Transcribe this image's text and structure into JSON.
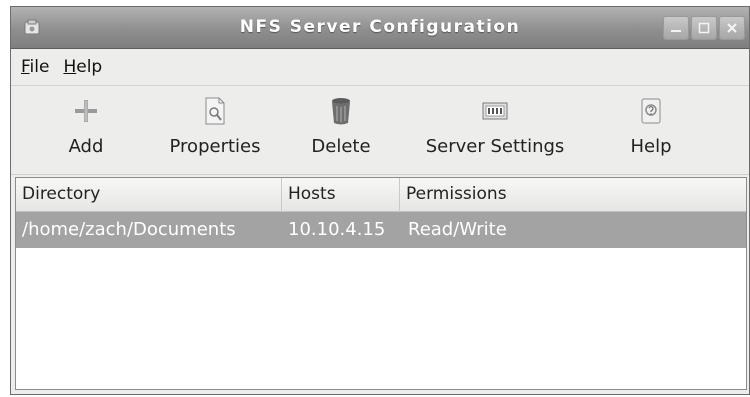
{
  "window": {
    "title": "NFS Server Configuration"
  },
  "menubar": {
    "items": [
      {
        "mnemonic": "F",
        "rest": "ile"
      },
      {
        "mnemonic": "H",
        "rest": "elp"
      }
    ]
  },
  "toolbar": {
    "add_label": "Add",
    "properties_label": "Properties",
    "delete_label": "Delete",
    "server_settings_label": "Server Settings",
    "help_label": "Help"
  },
  "table": {
    "columns": [
      "Directory",
      "Hosts",
      "Permissions"
    ],
    "rows": [
      {
        "directory": "/home/zach/Documents",
        "hosts": "10.10.4.15",
        "permissions": "Read/Write",
        "selected": true
      }
    ]
  },
  "colors": {
    "selected_row": "#a3a3a3",
    "titlebar": "#8f8f8f"
  },
  "icons": {
    "app": "nfs-app-icon",
    "add": "plus-icon",
    "properties": "properties-icon",
    "delete": "trash-icon",
    "server_settings": "server-settings-icon",
    "help": "help-icon"
  }
}
